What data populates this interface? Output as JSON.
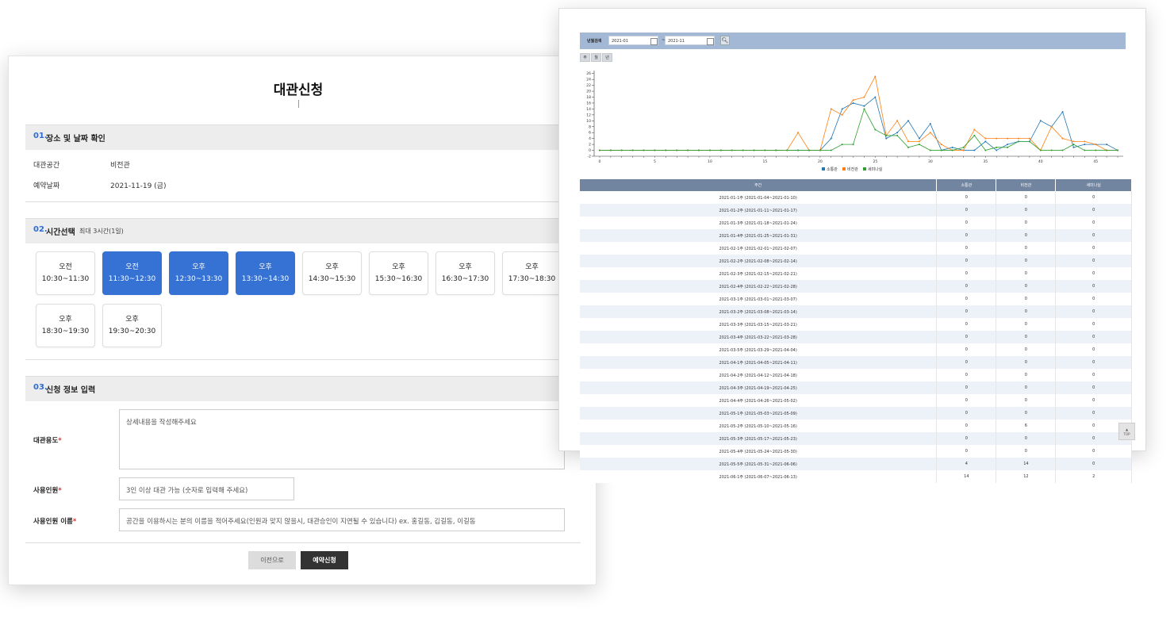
{
  "form": {
    "title": "대관신청",
    "section1": {
      "num": "01.",
      "title": "장소 및 날짜 확인"
    },
    "info": [
      {
        "label": "대관공간",
        "value": "비전관"
      },
      {
        "label": "예약날짜",
        "value": "2021-11-19 (금)"
      }
    ],
    "section2": {
      "num": "02.",
      "title": "시간선택",
      "sub": "최대 3시간(1일)"
    },
    "slots": [
      {
        "period": "오전",
        "time": "10:30~11:30",
        "selected": false
      },
      {
        "period": "오전",
        "time": "11:30~12:30",
        "selected": true
      },
      {
        "period": "오후",
        "time": "12:30~13:30",
        "selected": true
      },
      {
        "period": "오후",
        "time": "13:30~14:30",
        "selected": true
      },
      {
        "period": "오후",
        "time": "14:30~15:30",
        "selected": false
      },
      {
        "period": "오후",
        "time": "15:30~16:30",
        "selected": false
      },
      {
        "period": "오후",
        "time": "16:30~17:30",
        "selected": false
      },
      {
        "period": "오후",
        "time": "17:30~18:30",
        "selected": false
      },
      {
        "period": "오후",
        "time": "18:30~19:30",
        "selected": false
      },
      {
        "period": "오후",
        "time": "19:30~20:30",
        "selected": false
      }
    ],
    "section3": {
      "num": "03.",
      "title": "신청 정보 입력"
    },
    "fields": {
      "purpose": {
        "label": "대관용도",
        "placeholder": "상세내용을 작성해주세요"
      },
      "count": {
        "label": "사용인원",
        "placeholder": "3인 이상 대관 가능 (숫자로 입력해 주세요)"
      },
      "names": {
        "label": "사용인원 이름",
        "placeholder": "공간을 이용하시는 분의 이름을 적어주세요(인원과 맞지 않을시, 대관승인이 지연될 수 있습니다) ex. 홍길동, 김길동, 이길동"
      }
    },
    "required_mark": "*",
    "buttons": {
      "prev": "이전으로",
      "submit": "예약신청"
    }
  },
  "stats": {
    "search_label": "년월검색",
    "from": "2021-01",
    "to": "2021-11",
    "tilde": "~",
    "search_icon": "search-icon",
    "tabs": [
      "주",
      "월",
      "년"
    ],
    "table_headers": [
      "주간",
      "소통관",
      "비전관",
      "새미나실"
    ],
    "rows": [
      [
        "2021-01-1주 (2021-01-04~2021-01-10)",
        "0",
        "0",
        "0"
      ],
      [
        "2021-01-2주 (2021-01-11~2021-01-17)",
        "0",
        "0",
        "0"
      ],
      [
        "2021-01-3주 (2021-01-18~2021-01-24)",
        "0",
        "0",
        "0"
      ],
      [
        "2021-01-4주 (2021-01-25~2021-01-31)",
        "0",
        "0",
        "0"
      ],
      [
        "2021-02-1주 (2021-02-01~2021-02-07)",
        "0",
        "0",
        "0"
      ],
      [
        "2021-02-2주 (2021-02-08~2021-02-14)",
        "0",
        "0",
        "0"
      ],
      [
        "2021-02-3주 (2021-02-15~2021-02-21)",
        "0",
        "0",
        "0"
      ],
      [
        "2021-02-4주 (2021-02-22~2021-02-28)",
        "0",
        "0",
        "0"
      ],
      [
        "2021-03-1주 (2021-03-01~2021-03-07)",
        "0",
        "0",
        "0"
      ],
      [
        "2021-03-2주 (2021-03-08~2021-03-14)",
        "0",
        "0",
        "0"
      ],
      [
        "2021-03-3주 (2021-03-15~2021-03-21)",
        "0",
        "0",
        "0"
      ],
      [
        "2021-03-4주 (2021-03-22~2021-03-28)",
        "0",
        "0",
        "0"
      ],
      [
        "2021-03-5주 (2021-03-29~2021-04-04)",
        "0",
        "0",
        "0"
      ],
      [
        "2021-04-1주 (2021-04-05~2021-04-11)",
        "0",
        "0",
        "0"
      ],
      [
        "2021-04-2주 (2021-04-12~2021-04-18)",
        "0",
        "0",
        "0"
      ],
      [
        "2021-04-3주 (2021-04-19~2021-04-25)",
        "0",
        "0",
        "0"
      ],
      [
        "2021-04-4주 (2021-04-26~2021-05-02)",
        "0",
        "0",
        "0"
      ],
      [
        "2021-05-1주 (2021-05-03~2021-05-09)",
        "0",
        "0",
        "0"
      ],
      [
        "2021-05-2주 (2021-05-10~2021-05-16)",
        "0",
        "6",
        "0"
      ],
      [
        "2021-05-3주 (2021-05-17~2021-05-23)",
        "0",
        "0",
        "0"
      ],
      [
        "2021-05-4주 (2021-05-24~2021-05-30)",
        "0",
        "0",
        "0"
      ],
      [
        "2021-05-5주 (2021-05-31~2021-06-06)",
        "4",
        "14",
        "0"
      ],
      [
        "2021-06-1주 (2021-06-07~2021-06-13)",
        "14",
        "12",
        "2"
      ]
    ],
    "top_label": "TOP"
  },
  "chart_data": {
    "type": "line",
    "x": [
      0,
      1,
      2,
      3,
      4,
      5,
      6,
      7,
      8,
      9,
      10,
      11,
      12,
      13,
      14,
      15,
      16,
      17,
      18,
      19,
      20,
      21,
      22,
      23,
      24,
      25,
      26,
      27,
      28,
      29,
      30,
      31,
      32,
      33,
      34,
      35,
      36,
      37,
      38,
      39,
      40,
      41,
      42,
      43,
      44,
      45,
      46,
      47
    ],
    "xticks": [
      0,
      5,
      10,
      15,
      20,
      25,
      30,
      35,
      40,
      45
    ],
    "yticks": [
      -2,
      0,
      2,
      4,
      6,
      8,
      10,
      12,
      14,
      16,
      18,
      20,
      22,
      24,
      26
    ],
    "xlim": [
      -0.5,
      47.5
    ],
    "ylim": [
      -2,
      27
    ],
    "series": [
      {
        "name": "소통관",
        "color": "#1f77b4",
        "values": [
          0,
          0,
          0,
          0,
          0,
          0,
          0,
          0,
          0,
          0,
          0,
          0,
          0,
          0,
          0,
          0,
          0,
          0,
          0,
          0,
          0,
          4,
          14,
          16,
          15,
          18,
          4,
          6,
          10,
          4,
          9,
          0,
          1,
          0,
          0,
          3,
          0,
          2,
          3,
          3,
          10,
          8,
          13,
          1,
          2,
          2,
          2,
          0
        ]
      },
      {
        "name": "비전관",
        "color": "#ff7f0e",
        "values": [
          0,
          0,
          0,
          0,
          0,
          0,
          0,
          0,
          0,
          0,
          0,
          0,
          0,
          0,
          0,
          0,
          0,
          0,
          6,
          0,
          0,
          14,
          12,
          17,
          18,
          25,
          5,
          10,
          3,
          3,
          6,
          2,
          0,
          0,
          7,
          4,
          4,
          4,
          4,
          4,
          0,
          8,
          4,
          3,
          3,
          2,
          0,
          0
        ]
      },
      {
        "name": "세미나실",
        "color": "#2ca02c",
        "values": [
          0,
          0,
          0,
          0,
          0,
          0,
          0,
          0,
          0,
          0,
          0,
          0,
          0,
          0,
          0,
          0,
          0,
          0,
          0,
          0,
          0,
          0,
          2,
          2,
          14,
          7,
          5,
          5,
          1,
          2,
          0,
          0,
          0,
          1,
          5,
          0,
          1,
          1,
          3,
          3,
          0,
          0,
          0,
          2,
          0,
          0,
          0,
          0
        ]
      }
    ]
  }
}
